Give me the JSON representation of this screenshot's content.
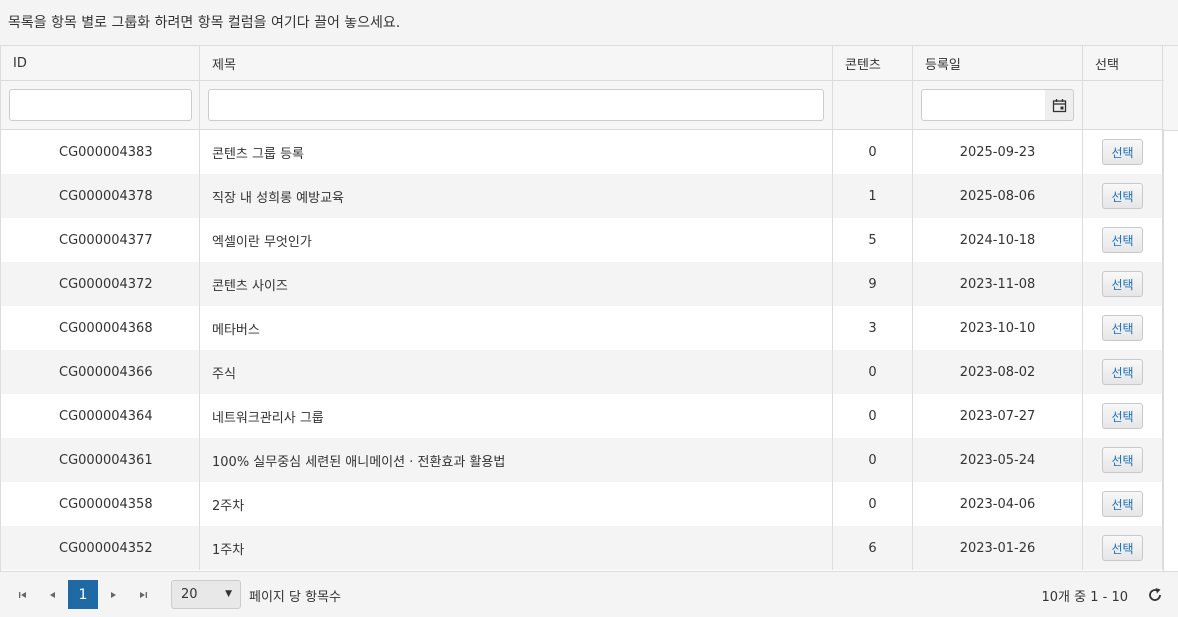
{
  "group_hint": "목록을 항목 별로 그룹화 하려면 항목 컬럼을 여기다 끌어 놓으세요.",
  "columns": {
    "id": "ID",
    "title": "제목",
    "contents": "콘텐츠",
    "date": "등록일",
    "select": "선택"
  },
  "rows": [
    {
      "id": "CG000004383",
      "title": "콘텐츠 그룹 등록",
      "contents": "0",
      "date": "2025-09-23",
      "select": "선택"
    },
    {
      "id": "CG000004378",
      "title": "직장 내 성희롱 예방교육",
      "contents": "1",
      "date": "2025-08-06",
      "select": "선택"
    },
    {
      "id": "CG000004377",
      "title": "엑셀이란 무엇인가",
      "contents": "5",
      "date": "2024-10-18",
      "select": "선택"
    },
    {
      "id": "CG000004372",
      "title": "콘텐츠 사이즈",
      "contents": "9",
      "date": "2023-11-08",
      "select": "선택"
    },
    {
      "id": "CG000004368",
      "title": "메타버스",
      "contents": "3",
      "date": "2023-10-10",
      "select": "선택"
    },
    {
      "id": "CG000004366",
      "title": "주식",
      "contents": "0",
      "date": "2023-08-02",
      "select": "선택"
    },
    {
      "id": "CG000004364",
      "title": "네트워크관리사 그룹",
      "contents": "0",
      "date": "2023-07-27",
      "select": "선택"
    },
    {
      "id": "CG000004361",
      "title": "100% 실무중심 세련된 애니메이션 · 전환효과 활용법",
      "contents": "0",
      "date": "2023-05-24",
      "select": "선택"
    },
    {
      "id": "CG000004358",
      "title": "2주차",
      "contents": "0",
      "date": "2023-04-06",
      "select": "선택"
    },
    {
      "id": "CG000004352",
      "title": "1주차",
      "contents": "6",
      "date": "2023-01-26",
      "select": "선택"
    }
  ],
  "pager": {
    "current_page": "1",
    "page_size": "20",
    "per_page_label": "페이지 당 항목수",
    "range_text": "10개 중 1 - 10"
  },
  "icons": {
    "first": "first-page-icon",
    "prev": "prev-page-icon",
    "next": "next-page-icon",
    "last": "last-page-icon",
    "calendar": "calendar-icon",
    "refresh": "refresh-icon"
  },
  "colors": {
    "accent": "#1f6aa5",
    "select_text": "#1a70b8",
    "alt_row": "#f4f4f4"
  }
}
